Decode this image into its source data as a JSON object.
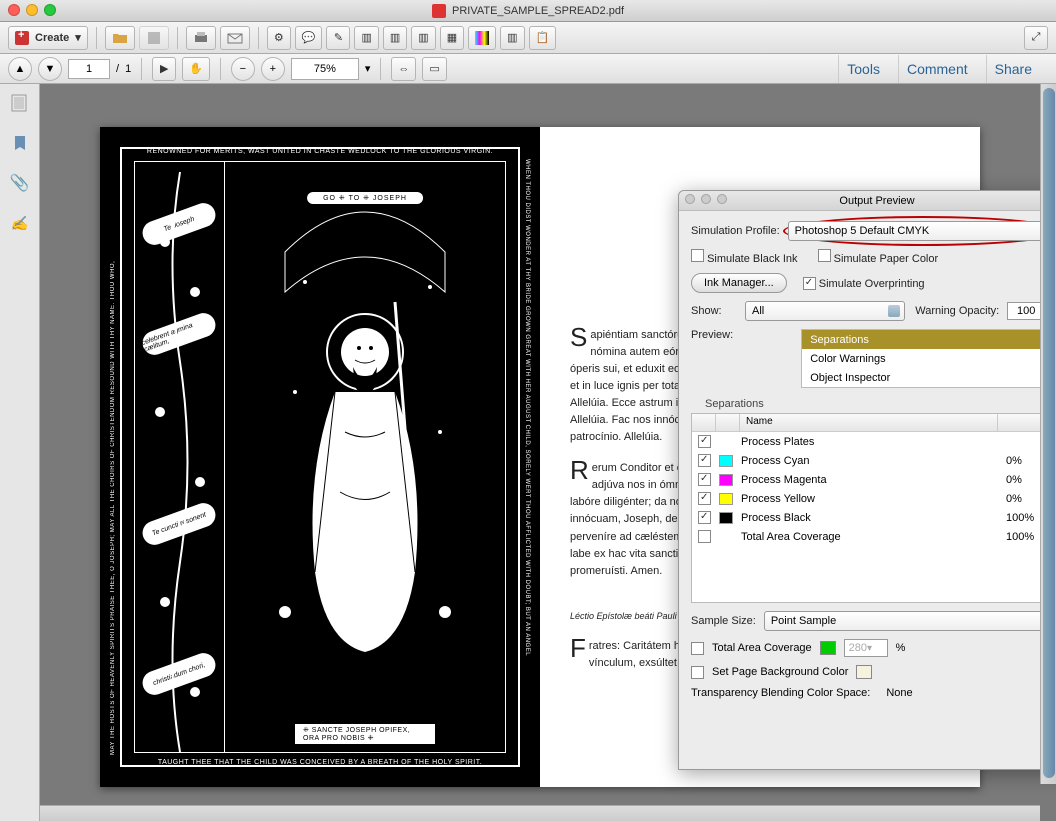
{
  "window": {
    "title": "PRIVATE_SAMPLE_SPREAD2.pdf"
  },
  "toolbar": {
    "create_label": "Create"
  },
  "nav": {
    "page_current": "1",
    "page_sep": "/",
    "page_total": "1",
    "zoom": "75%"
  },
  "right_links": {
    "tools": "Tools",
    "comment": "Comment",
    "share": "Share"
  },
  "document": {
    "woodcut": {
      "top": "RENOWNED FOR MERITS, WAST UNITED IN CHASTE WEDLOCK TO THE GLORIOUS VIRGIN.",
      "left": "MAY THE HOSTS OF HEAVENLY SPIRITS PRAISE THEE, O JOSEPH; MAY ALL THE CHOIRS OF CHRISTENDOM RESOUND WITH THY NAME. THOU WHO,",
      "right": "WHEN THOU DIDST WONDER AT THY BRIDE GROWN GREAT WITH HER AUGUST CHILD, SORELY WERT THOU AFFLICTED WITH DOUBT; BUT AN ANGEL",
      "bottom": "TAUGHT THEE THAT THE CHILD WAS CONCEIVED BY A BREATH OF THE HOLY SPIRIT.",
      "go_banner": "GO ⁜ TO ⁜ JOSEPH",
      "ribbon1": "Te Joseph",
      "ribbon2": "celebrent agmina cælitum,",
      "ribbon3": "Te cuncti resonent",
      "ribbon4": "christiadum chori,",
      "caption": "⁜ SANCTE JOSEPH OPIFEX, ORA PRO NOBIS ⁜"
    },
    "body": {
      "p1_cap": "S",
      "p1": "apiéntiam sanctórum narrent pópuli, et laudes eórum núntiet ecclésia; nómina autem eórum vivent in sǽculum sǽculi. Cum dedúxit Israel óperis sui, et eduxit eos in exsultatióne. ℣. Allelúia. Ecce fuit illís in stella diéi, et in luce ignis per totam noctem: Amávit eum luce stellárum ornávit eum. ℣. Allelúia. Ecce astrum illud gaudébit alleluia, allelúia: et omnes in lætítia. Allelúia. Fac nos innócuam, Joseph, decúrrere vitam: sitque tuo semper tuta patrocínio. Allelúia.",
      "p2_cap": "R",
      "p2": "erum Conditor et cónjugi tuæ Vírgini Deíparæ fidelíssime astitísti: lege adjúva nos in ómnibus necessitátibus nostris. Amen nos géneri statúti in labóre diligénter; da nobis proptérea méritis et précibus ut sancto. Fac nos innócuam, Joseph, decúrrere vitam: sitque tuo semper trocínio, ac per te perveníre ad cæléstem pátriam. Amen beatíssimi Joseph præcípius et sine labe ex hac vita sanctificémur: et ejúsdem gáudiis perfruámur quæ promeruísti. Amen.",
      "heading": "Léctio Epístolæ beáti Pauli Apóstoli ad Colossénses.",
      "p3_cap": "F",
      "p3": "ratres: Caritátem habéte, quod est vínculum perfectiónis: et pax quod est vínculum, exsúltet in córdibus."
    }
  },
  "panel": {
    "title": "Output Preview",
    "sim_profile_label": "Simulation Profile:",
    "sim_profile_value": "Photoshop 5 Default CMYK",
    "simulate_black_ink": "Simulate Black Ink",
    "simulate_paper_color": "Simulate Paper Color",
    "ink_manager": "Ink Manager...",
    "simulate_overprinting": "Simulate Overprinting",
    "show_label": "Show:",
    "show_value": "All",
    "warning_opacity_label": "Warning Opacity:",
    "warning_opacity_value": "100",
    "percent": "%",
    "preview_label": "Preview:",
    "preview_options": [
      "Separations",
      "Color Warnings",
      "Object Inspector"
    ],
    "separations_title": "Separations",
    "name_header": "Name",
    "rows": [
      {
        "checked": true,
        "color": "",
        "name": "Process Plates",
        "pct": ""
      },
      {
        "checked": true,
        "color": "#00ffff",
        "name": "Process Cyan",
        "pct": "0%"
      },
      {
        "checked": true,
        "color": "#ff00ff",
        "name": "Process Magenta",
        "pct": "0%"
      },
      {
        "checked": true,
        "color": "#ffff00",
        "name": "Process Yellow",
        "pct": "0%"
      },
      {
        "checked": true,
        "color": "#000000",
        "name": "Process Black",
        "pct": "100%"
      },
      {
        "checked": false,
        "color": "",
        "name": "Total Area Coverage",
        "pct": "100%"
      }
    ],
    "sample_size_label": "Sample Size:",
    "sample_size_value": "Point Sample",
    "total_area_coverage": "Total Area Coverage",
    "tac_color": "#00cc00",
    "tac_value": "280",
    "set_page_bg": "Set Page Background Color",
    "bg_swatch": "#f7f2e0",
    "transparency_label": "Transparency Blending Color Space:",
    "transparency_value": "None"
  }
}
